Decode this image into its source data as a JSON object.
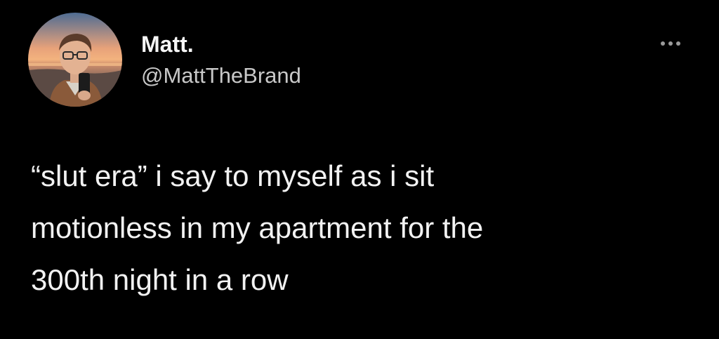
{
  "author": {
    "display_name": "Matt.",
    "handle": "@MattTheBrand",
    "avatar_icon": "profile-photo"
  },
  "menu": {
    "icon": "more-dots-icon"
  },
  "tweet": {
    "lines": [
      "“slut era” i say to myself as i sit",
      "motionless in my apartment for the",
      "300th night in a row"
    ]
  },
  "colors": {
    "background": "#000000",
    "text": "#f2f2f2",
    "secondary_text": "#c8c8c8"
  }
}
